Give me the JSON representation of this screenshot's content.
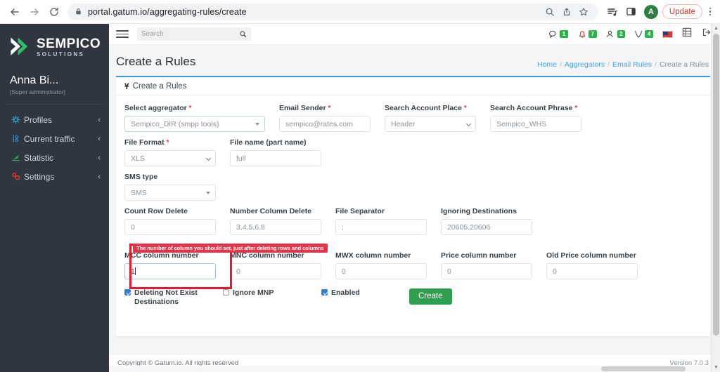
{
  "browser": {
    "url": "portal.gatum.io/aggregating-rules/create",
    "back_icon": "back-arrow-icon",
    "forward_icon": "forward-arrow-icon",
    "reload_icon": "reload-icon",
    "lock_icon": "lock-icon",
    "zoom_icon": "search-zoom-icon",
    "share_icon": "share-icon",
    "bookmark_icon": "star-icon",
    "reading_list_icon": "reading-list-icon",
    "side_panel_icon": "side-panel-icon",
    "profile_initial": "A",
    "update_label": "Update",
    "menu_icon": "kebab-menu-icon"
  },
  "sidebar": {
    "logo_top": "SEMPICO",
    "logo_sub": "SOLUTIONS",
    "user_name": "Anna Bi...",
    "user_role": "[Super administrator]",
    "items": [
      {
        "label": "Profiles",
        "icon": "profiles-icon",
        "chevron": "‹"
      },
      {
        "label": "Current traffic",
        "icon": "traffic-icon",
        "chevron": "‹"
      },
      {
        "label": "Statistic",
        "icon": "statistic-icon",
        "chevron": "‹"
      },
      {
        "label": "Settings",
        "icon": "settings-gear-icon",
        "chevron": "‹"
      }
    ]
  },
  "topbar": {
    "menu_icon": "hamburger-icon",
    "search_placeholder": "Search",
    "search_icon": "search-icon",
    "indicators": [
      {
        "icon": "chat-icon",
        "count": "1"
      },
      {
        "icon": "notification-bell-icon",
        "count": "7"
      },
      {
        "icon": "users-icon",
        "count": "2"
      },
      {
        "icon": "activity-icon",
        "count": "4"
      }
    ],
    "flag_icon": "us-flag-icon",
    "grid_icon": "grid-apps-icon",
    "logout_icon": "logout-icon"
  },
  "page": {
    "title": "Create a Rules",
    "breadcrumb": [
      {
        "label": "Home",
        "link": true
      },
      {
        "label": "Aggregators",
        "link": true
      },
      {
        "label": "Email Rules",
        "link": true
      },
      {
        "label": "Create a Rules",
        "link": false
      }
    ]
  },
  "card": {
    "header_icon": "u-icon",
    "header_title": "Create a Rules",
    "warning": "The number of column you should set, just after deleting rows and columns",
    "fields": {
      "select_aggregator": {
        "label": "Select aggregator",
        "required": true,
        "value": "Sempico_DIR (smpp tools)",
        "type": "select"
      },
      "email_sender": {
        "label": "Email Sender",
        "required": true,
        "value": "sempico@rates.com",
        "type": "text"
      },
      "search_account_place": {
        "label": "Search Account Place",
        "required": true,
        "value": "Header",
        "type": "select"
      },
      "search_account_phrase": {
        "label": "Search Account Phrase",
        "required": true,
        "value": "Sempico_WHS",
        "type": "text"
      },
      "file_format": {
        "label": "File Format",
        "required": true,
        "value": "XLS",
        "type": "select"
      },
      "file_name": {
        "label": "File name (part name)",
        "required": false,
        "value": "full",
        "type": "text"
      },
      "sms_type": {
        "label": "SMS type",
        "required": false,
        "value": "SMS",
        "type": "select"
      },
      "count_row_delete": {
        "label": "Count Row Delete",
        "required": false,
        "value": "0",
        "type": "text"
      },
      "number_column_delete": {
        "label": "Number Column Delete",
        "required": false,
        "value": "3,4,5,6,8",
        "type": "text"
      },
      "file_separator": {
        "label": "File Separator",
        "required": false,
        "value": ";",
        "type": "text"
      },
      "ignoring_destinations": {
        "label": "Ignoring Destinations",
        "required": false,
        "value": "20605,20606",
        "type": "text"
      },
      "mcc_column_number": {
        "label": "MCC column number",
        "required": false,
        "value": "1",
        "type": "text",
        "focused": true
      },
      "mnc_column_number": {
        "label": "MNC column number",
        "required": false,
        "value": "0",
        "type": "text"
      },
      "mwx_column_number": {
        "label": "MWX column number",
        "required": false,
        "value": "0",
        "type": "text"
      },
      "price_column_number": {
        "label": "Price column number",
        "required": false,
        "value": "0",
        "type": "text"
      },
      "old_price_column_number": {
        "label": "Old Price column number",
        "required": false,
        "value": "0",
        "type": "text"
      }
    },
    "checkboxes": [
      {
        "label": "Deleting Not Exist Destinations",
        "checked": true
      },
      {
        "label": "Ignore MNP",
        "checked": false
      },
      {
        "label": "Enabled",
        "checked": true
      }
    ],
    "submit_label": "Create",
    "submit_color": "#2f9e4f"
  },
  "footer": {
    "copyright": "Copyright © Gatum.io. All rights reserved",
    "version_label": "Version",
    "version_value": "7.0.3"
  }
}
